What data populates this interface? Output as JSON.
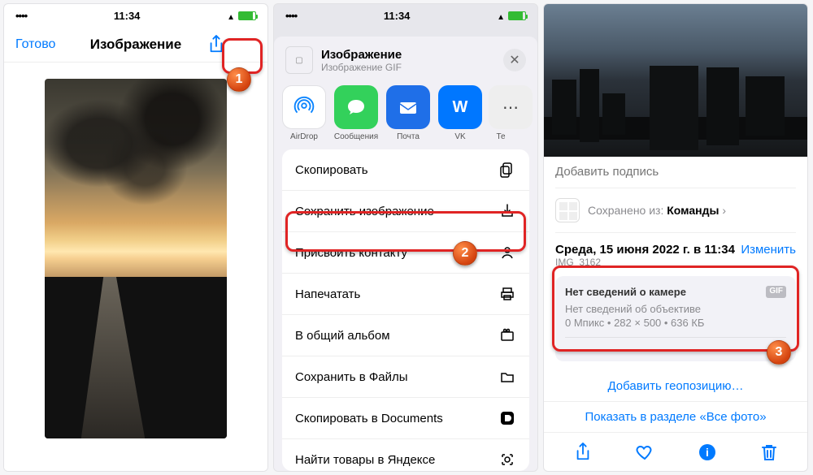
{
  "statusbar": {
    "time": "11:34"
  },
  "panel1": {
    "done": "Готово",
    "title": "Изображение"
  },
  "panel2": {
    "file_title": "Изображение",
    "file_sub": "Изображение GIF",
    "share_apps": {
      "airdrop": "AirDrop",
      "messages": "Сообщения",
      "mail": "Почта",
      "vk": "VK",
      "more": "Те"
    },
    "actions": {
      "copy": "Скопировать",
      "save_image": "Сохранить изображение",
      "assign_contact": "Присвоить контакту",
      "print": "Напечатать",
      "shared_album": "В общий альбом",
      "save_files": "Сохранить в Файлы",
      "copy_docs": "Скопировать в Documents",
      "yandex": "Найти товары в Яндексе"
    }
  },
  "panel3": {
    "caption_placeholder": "Добавить подпись",
    "saved_from_prefix": "Сохранено из: ",
    "saved_from_app": "Команды",
    "date": "Среда, 15 июня 2022 г. в 11:34",
    "filename": "IMG_3162",
    "edit": "Изменить",
    "camera_info": "Нет сведений о камере",
    "gif_badge": "GIF",
    "lens_info": "Нет сведений об объективе",
    "specs": "0 Мпикс • 282 × 500 • 636 КБ",
    "add_geo": "Добавить геопозицию…",
    "show_all": "Показать в разделе «Все фото»"
  },
  "steps": {
    "s1": "1",
    "s2": "2",
    "s3": "3"
  }
}
